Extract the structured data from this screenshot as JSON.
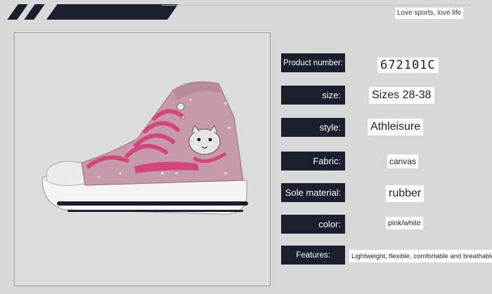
{
  "header": {
    "slogan": "Love sports, love life"
  },
  "product_image": {
    "description_icon": "sneaker-photo",
    "colors": {
      "upper": "#c79aab",
      "trim": "#d2467d",
      "sole": "#f4f4f4",
      "stripe": "#1b1e2c"
    }
  },
  "specs": [
    {
      "label": "Product number:",
      "value": "672101C"
    },
    {
      "label": "size:",
      "value": "Sizes 28-38"
    },
    {
      "label": "style:",
      "value": "Athleisure"
    },
    {
      "label": "Fabric:",
      "value": "canvas"
    },
    {
      "label": "Sole material:",
      "value": "rubber"
    },
    {
      "label": "color:",
      "value": "pink/white"
    },
    {
      "label": "Features:",
      "value": "Lightweight, flexible, comfortable and breathable"
    }
  ],
  "colors": {
    "background": "#d8d8d8",
    "label_bg": "#1b1e2c",
    "label_text": "#ffffff",
    "value_bg": "#ffffff"
  }
}
